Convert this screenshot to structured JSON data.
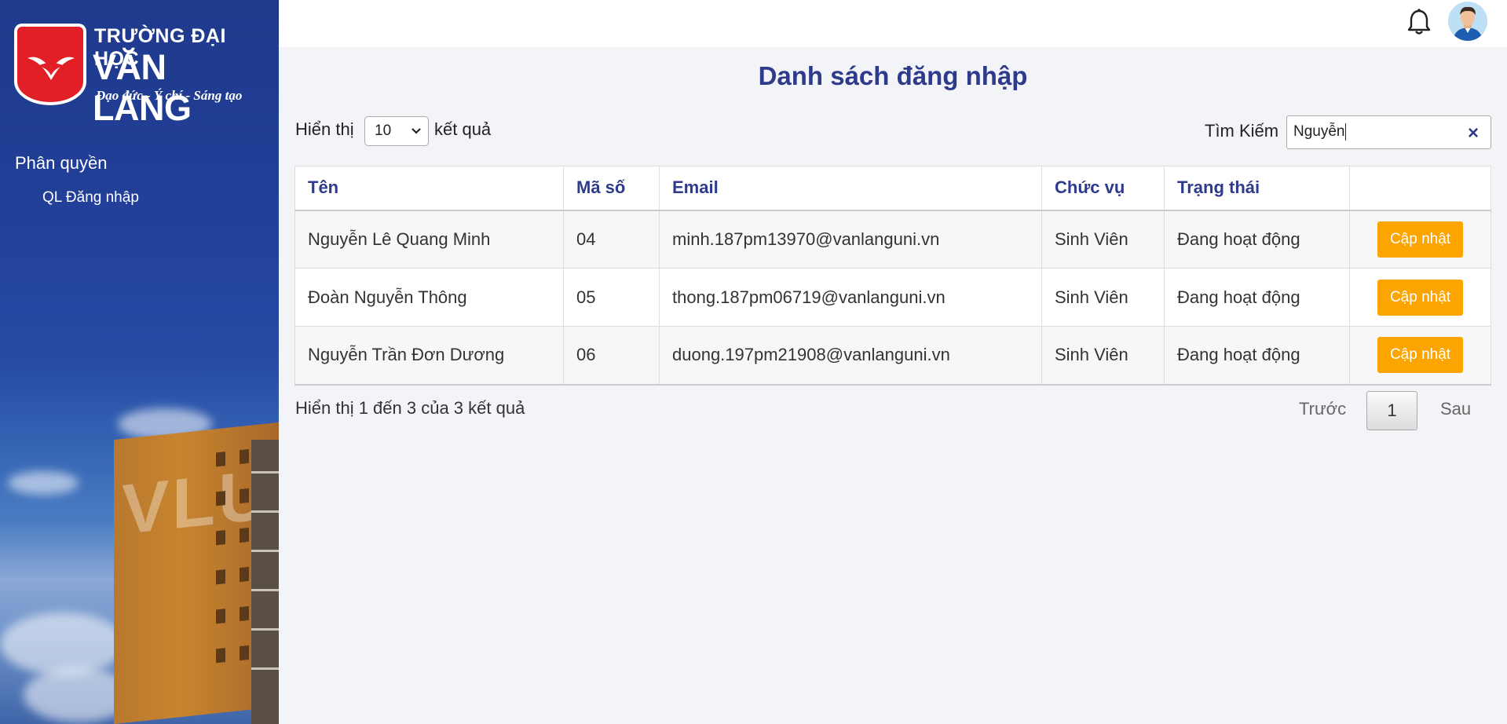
{
  "brand": {
    "line1": "TRƯỜNG ĐẠI HỌC",
    "line2": "VĂN LANG",
    "slogan": "Đạo đức - Ý chí - Sáng tạo",
    "building_text": "VLU",
    "accent_color": "#e21f26"
  },
  "sidebar": {
    "section_title": "Phân quyền",
    "items": [
      {
        "label": "QL Đăng nhập"
      }
    ]
  },
  "topbar": {
    "icons": [
      "bell-icon",
      "user-avatar"
    ]
  },
  "page": {
    "title": "Danh sách đăng nhập"
  },
  "controls": {
    "length_prefix": "Hiển thị",
    "length_value": "10",
    "length_suffix": "kết quả",
    "search_label": "Tìm Kiếm",
    "search_value": "Nguyễn"
  },
  "table": {
    "headers": [
      "Tên",
      "Mã số",
      "Email",
      "Chức vụ",
      "Trạng thái",
      ""
    ],
    "rows": [
      {
        "name": "Nguyễn Lê Quang Minh",
        "code": "04",
        "email": "minh.187pm13970@vanlanguni.vn",
        "role": "Sinh Viên",
        "status": "Đang hoạt động",
        "action": "Cập nhật"
      },
      {
        "name": "Đoàn Nguyễn Thông",
        "code": "05",
        "email": "thong.187pm06719@vanlanguni.vn",
        "role": "Sinh Viên",
        "status": "Đang hoạt động",
        "action": "Cập nhật"
      },
      {
        "name": "Nguyễn Trần Đơn Dương",
        "code": "06",
        "email": "duong.197pm21908@vanlanguni.vn",
        "role": "Sinh Viên",
        "status": "Đang hoạt động",
        "action": "Cập nhật"
      }
    ]
  },
  "footer": {
    "info": "Hiển thị 1 đến 3 của 3 kết quả",
    "prev": "Trước",
    "current_page": "1",
    "next": "Sau"
  },
  "colors": {
    "title": "#2e3a8c",
    "button": "#fca400",
    "sidebar": "#22409a"
  }
}
